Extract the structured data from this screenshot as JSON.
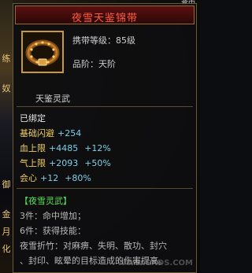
{
  "game_bg": {
    "fragments": [
      "练",
      "奴",
      "御",
      "金",
      "月",
      "化"
    ],
    "top_right": "盒中"
  },
  "tooltip": {
    "title": "夜雪天鉴锦带",
    "carry_level": {
      "label": "携带等级：",
      "value": "85级"
    },
    "grade": {
      "label": "品阶：",
      "value": "天阶"
    },
    "sub_name": "天鉴灵武",
    "bound": "已绑定",
    "stats": [
      {
        "name": "基础闪避",
        "v1": "+254",
        "v2": ""
      },
      {
        "name": "血上限",
        "v1": "+4485",
        "v2": "+12%"
      },
      {
        "name": "气上限",
        "v1": "+2093",
        "v2": "+50%"
      },
      {
        "name": "会心",
        "v1": "+12",
        "v2": "+80%"
      }
    ],
    "set": {
      "title": "【夜雪灵武】",
      "lines": [
        "3件：命中增加；",
        "6件：获得技能：",
        "夜雪折竹：对麻痹、失明、散功、封穴",
        "、封印、眩晕的目标造成的伤害提高。"
      ]
    },
    "watermark": "WWW.SXDS.COM"
  },
  "colors": {
    "title": "#ff5a3a",
    "stat_name": "#f0d060",
    "stat_value": "#7fd0e8",
    "set_green": "#58e058"
  }
}
